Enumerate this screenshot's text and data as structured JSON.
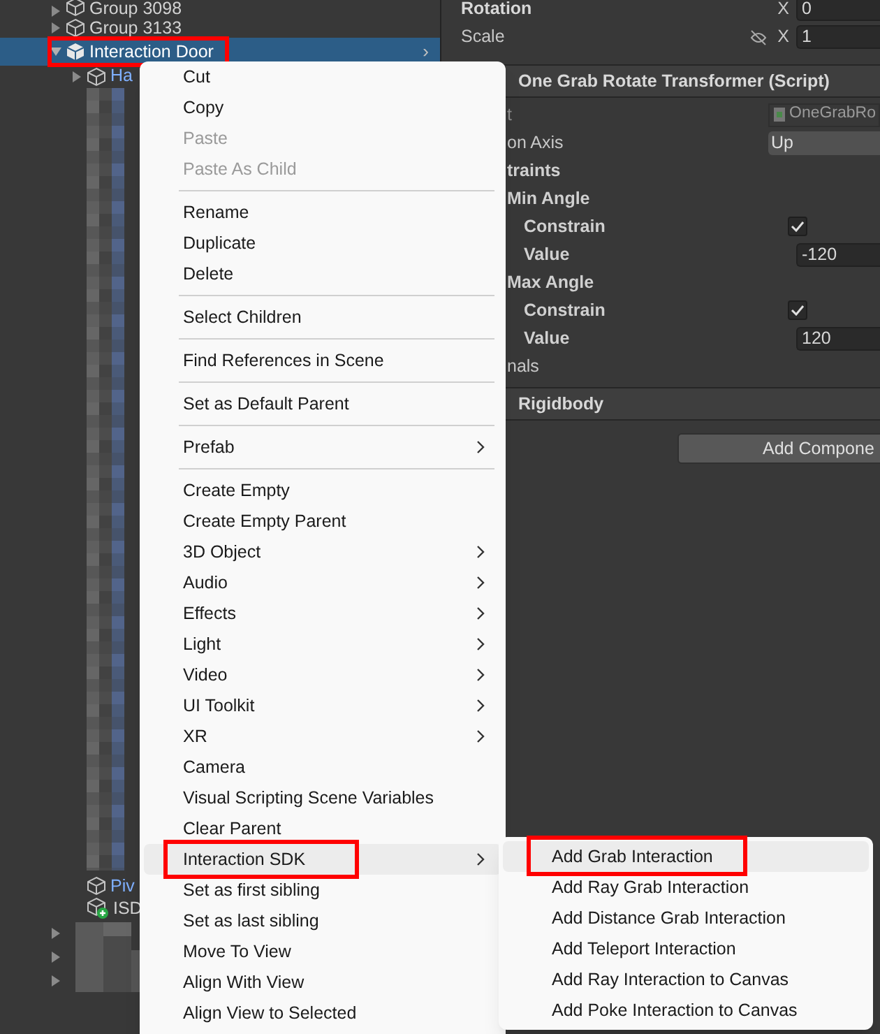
{
  "hierarchy": {
    "top_rows": [
      {
        "label": "Group 3098",
        "selected": false,
        "expanded": false,
        "prefab": false,
        "outlined": false
      },
      {
        "label": "Group 3133",
        "selected": false,
        "expanded": false,
        "prefab": false,
        "outlined": false
      },
      {
        "label": "Interaction Door",
        "selected": true,
        "expanded": true,
        "prefab": false,
        "outlined": true,
        "trailing": "›",
        "children": [
          {
            "label": "Ha",
            "selected": false,
            "expanded": false,
            "prefab": true
          }
        ]
      }
    ],
    "bottom_rows": [
      {
        "label": "Piv",
        "prefab": true,
        "added": false
      },
      {
        "label": "ISD",
        "prefab": false,
        "added": true
      }
    ]
  },
  "inspector": {
    "transform_rows": [
      {
        "label": "Rotation",
        "axis": "X",
        "value": "0",
        "linked": false
      },
      {
        "label": "Scale",
        "axis": "X",
        "value": "1",
        "linked": true
      }
    ],
    "component": {
      "title": "One Grab Rotate Transformer (Script)",
      "rows": [
        {
          "kind": "field",
          "label": "t",
          "value": "OneGrabRo",
          "script": true
        },
        {
          "kind": "field",
          "label": "on Axis",
          "value": "Up",
          "script": false
        },
        {
          "kind": "group",
          "label": "traints"
        },
        {
          "kind": "section",
          "label": "Min Angle"
        },
        {
          "kind": "check",
          "label": "Constrain",
          "checked": true
        },
        {
          "kind": "number",
          "label": "Value",
          "value": "-120"
        },
        {
          "kind": "section",
          "label": "Max Angle"
        },
        {
          "kind": "check",
          "label": "Constrain",
          "checked": true
        },
        {
          "kind": "number",
          "label": "Value",
          "value": "120"
        },
        {
          "kind": "plain",
          "label": "nals"
        }
      ]
    },
    "component_2": {
      "title": "Rigidbody"
    },
    "add_button": "Add Compone"
  },
  "context_menu": {
    "groups": [
      [
        {
          "label": "Cut",
          "disabled": false
        },
        {
          "label": "Copy",
          "disabled": false
        },
        {
          "label": "Paste",
          "disabled": true
        },
        {
          "label": "Paste As Child",
          "disabled": true
        }
      ],
      [
        {
          "label": "Rename",
          "disabled": false
        },
        {
          "label": "Duplicate",
          "disabled": false
        },
        {
          "label": "Delete",
          "disabled": false
        }
      ],
      [
        {
          "label": "Select Children",
          "disabled": false
        }
      ],
      [
        {
          "label": "Find References in Scene",
          "disabled": false
        }
      ],
      [
        {
          "label": "Set as Default Parent",
          "disabled": false
        }
      ],
      [
        {
          "label": "Prefab",
          "disabled": false,
          "submenu": true
        }
      ],
      [
        {
          "label": "Create Empty",
          "disabled": false
        },
        {
          "label": "Create Empty Parent",
          "disabled": false
        },
        {
          "label": "3D Object",
          "disabled": false,
          "submenu": true
        },
        {
          "label": "Audio",
          "disabled": false,
          "submenu": true
        },
        {
          "label": "Effects",
          "disabled": false,
          "submenu": true
        },
        {
          "label": "Light",
          "disabled": false,
          "submenu": true
        },
        {
          "label": "Video",
          "disabled": false,
          "submenu": true
        },
        {
          "label": "UI Toolkit",
          "disabled": false,
          "submenu": true
        },
        {
          "label": "XR",
          "disabled": false,
          "submenu": true
        },
        {
          "label": "Camera",
          "disabled": false
        },
        {
          "label": "Visual Scripting Scene Variables",
          "disabled": false
        },
        {
          "label": "Clear Parent",
          "disabled": false
        },
        {
          "label": "Interaction SDK",
          "disabled": false,
          "submenu": true,
          "selected": true,
          "outlined": true
        },
        {
          "label": "Set as first sibling",
          "disabled": false
        },
        {
          "label": "Set as last sibling",
          "disabled": false
        },
        {
          "label": "Move To View",
          "disabled": false
        },
        {
          "label": "Align With View",
          "disabled": false
        },
        {
          "label": "Align View to Selected",
          "disabled": false
        }
      ]
    ]
  },
  "submenu": {
    "items": [
      {
        "label": "Add Grab Interaction",
        "selected": true,
        "outlined": true
      },
      {
        "label": "Add Ray Grab Interaction",
        "selected": false,
        "outlined": false
      },
      {
        "label": "Add Distance Grab Interaction",
        "selected": false,
        "outlined": false
      },
      {
        "label": "Add Teleport Interaction",
        "selected": false,
        "outlined": false
      },
      {
        "label": "Add Ray Interaction to Canvas",
        "selected": false,
        "outlined": false
      },
      {
        "label": "Add Poke Interaction to Canvas",
        "selected": false,
        "outlined": false
      }
    ]
  }
}
